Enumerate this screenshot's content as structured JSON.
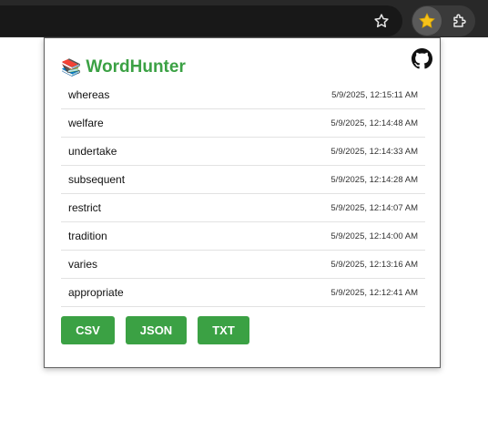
{
  "browser": {
    "bookmark_icon": "star-outline-icon",
    "active_extension_icon": "star-filled-icon",
    "extensions_icon": "puzzle-icon"
  },
  "popup": {
    "logo_emoji": "📚",
    "title": "WordHunter",
    "github_icon": "github-icon",
    "accent_color": "#3ba144",
    "words": [
      {
        "word": "whereas",
        "time": "5/9/2025, 12:15:11 AM"
      },
      {
        "word": "welfare",
        "time": "5/9/2025, 12:14:48 AM"
      },
      {
        "word": "undertake",
        "time": "5/9/2025, 12:14:33 AM"
      },
      {
        "word": "subsequent",
        "time": "5/9/2025, 12:14:28 AM"
      },
      {
        "word": "restrict",
        "time": "5/9/2025, 12:14:07 AM"
      },
      {
        "word": "tradition",
        "time": "5/9/2025, 12:14:00 AM"
      },
      {
        "word": "varies",
        "time": "5/9/2025, 12:13:16 AM"
      },
      {
        "word": "appropriate",
        "time": "5/9/2025, 12:12:41 AM"
      }
    ],
    "buttons": {
      "csv": "CSV",
      "json": "JSON",
      "txt": "TXT"
    }
  }
}
